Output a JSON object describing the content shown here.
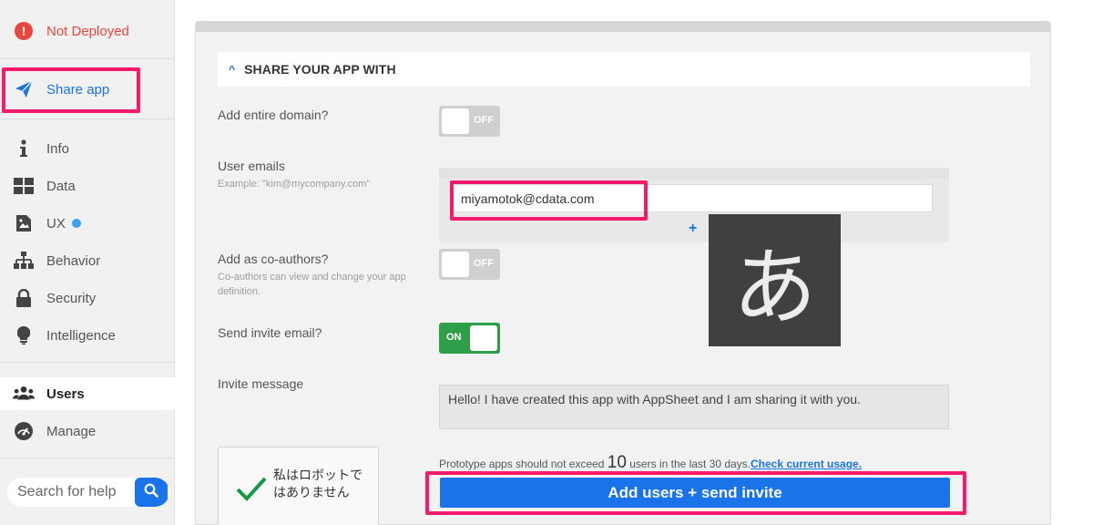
{
  "sidebar": {
    "status_label": "Not Deployed",
    "share_label": "Share app",
    "items": [
      {
        "label": "Info",
        "icon": "info-icon"
      },
      {
        "label": "Data",
        "icon": "data-grid-icon"
      },
      {
        "label": "UX",
        "icon": "ux-image-icon"
      },
      {
        "label": "Behavior",
        "icon": "behavior-tree-icon"
      },
      {
        "label": "Security",
        "icon": "lock-icon"
      },
      {
        "label": "Intelligence",
        "icon": "lightbulb-icon"
      }
    ],
    "users_label": "Users",
    "manage_label": "Manage",
    "search_placeholder": "Search for help"
  },
  "share": {
    "section_title": "SHARE YOUR APP WITH",
    "domain_label": "Add entire domain?",
    "domain_toggle": "OFF",
    "emails_label": "User emails",
    "emails_hint": "Example: \"kim@mycompany.com\"",
    "email_value": "miyamotok@cdata.com",
    "add_email_symbol": "+",
    "coauthors_label": "Add as co-authors?",
    "coauthors_hint": "Co-authors can view and change your app definition.",
    "coauthors_toggle": "OFF",
    "invite_label": "Send invite email?",
    "invite_toggle": "ON",
    "message_label": "Invite message",
    "message_value": "Hello! I have created this app with AppSheet and I am sharing it with you.",
    "proto_text_before": "Prototype apps should not exceed ",
    "proto_limit": "10",
    "proto_text_after": " users in the last 30 days.",
    "proto_link": "Check current usage.",
    "add_button": "Add users + send invite"
  },
  "captcha": {
    "text": "私はロボットではありません"
  },
  "ime": {
    "char": "あ"
  },
  "colors": {
    "accent": "#1a73e8",
    "highlight": "#f7196a",
    "error": "#e8453c",
    "toggle_on": "#2f9e4a"
  }
}
